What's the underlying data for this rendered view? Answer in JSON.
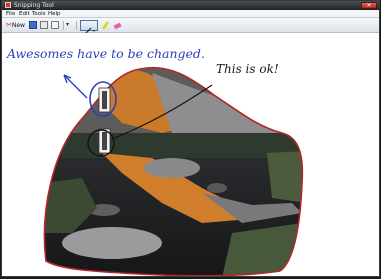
{
  "window": {
    "title": "Snipping Tool",
    "close_label": "✕"
  },
  "menu": {
    "items": [
      "File",
      "Edit",
      "Tools",
      "Help"
    ]
  },
  "toolbar": {
    "new_label": "New",
    "new_icon": "scissors-icon"
  },
  "annotations": {
    "blue_note": "Awesomes have to be changed.",
    "black_note": "This is ok!"
  },
  "colors": {
    "blue_ink": "#2b3fb8",
    "black_ink": "#1a1a1a",
    "red_outline": "#b3262b",
    "close_red": "#c0392b"
  }
}
